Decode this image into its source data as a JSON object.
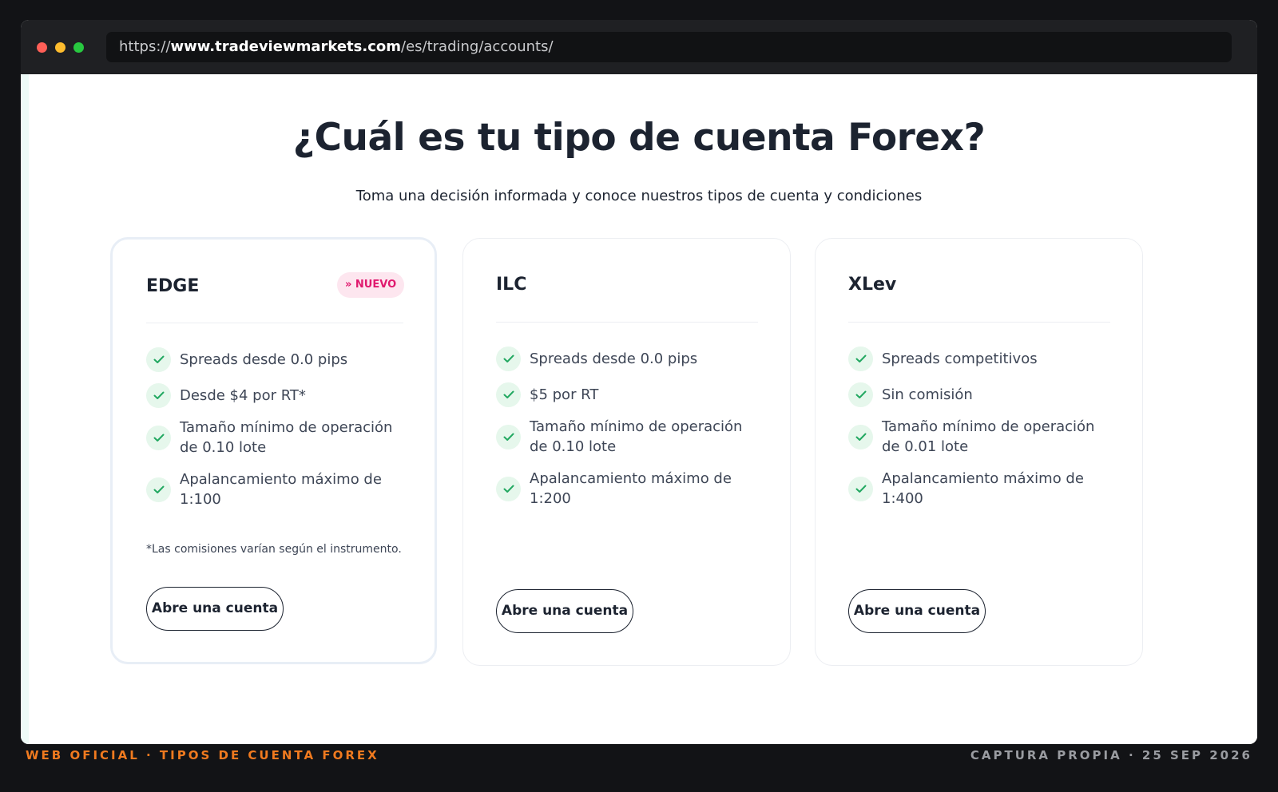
{
  "browser": {
    "url_protocol": "https://",
    "url_domain": "www.tradeviewmarkets.com",
    "url_path": "/es/trading/accounts/"
  },
  "page": {
    "title": "¿Cuál es tu tipo de cuenta Forex?",
    "subtitle": "Toma una decisión informada y conoce nuestros tipos de cuenta y condiciones"
  },
  "cards": [
    {
      "name": "EDGE",
      "badge": "» NUEVO",
      "features": [
        "Spreads desde 0.0 pips",
        "Desde $4 por RT*",
        "Tamaño mínimo de operación de 0.10 lote",
        "Apalancamiento máximo de 1:100"
      ],
      "note": "*Las comisiones varían según el instrumento.",
      "button": "Abre una cuenta"
    },
    {
      "name": "ILC",
      "features": [
        "Spreads desde 0.0 pips",
        "$5 por RT",
        "Tamaño mínimo de operación de 0.10 lote",
        "Apalancamiento máximo de 1:200"
      ],
      "button": "Abre una cuenta"
    },
    {
      "name": "XLev",
      "features": [
        "Spreads competitivos",
        "Sin comisión",
        "Tamaño mínimo de operación de 0.01 lote",
        "Apalancamiento máximo de 1:400"
      ],
      "button": "Abre una cuenta"
    }
  ],
  "captions": {
    "left": "WEB OFICIAL · TIPOS DE CUENTA FOREX",
    "right": "CAPTURA PROPIA · 25 SEP 2026"
  },
  "icons": {
    "check": "check-icon"
  },
  "colors": {
    "check": "#22a861",
    "badge": "#e0196e",
    "caption_accent": "#f07a1f"
  }
}
